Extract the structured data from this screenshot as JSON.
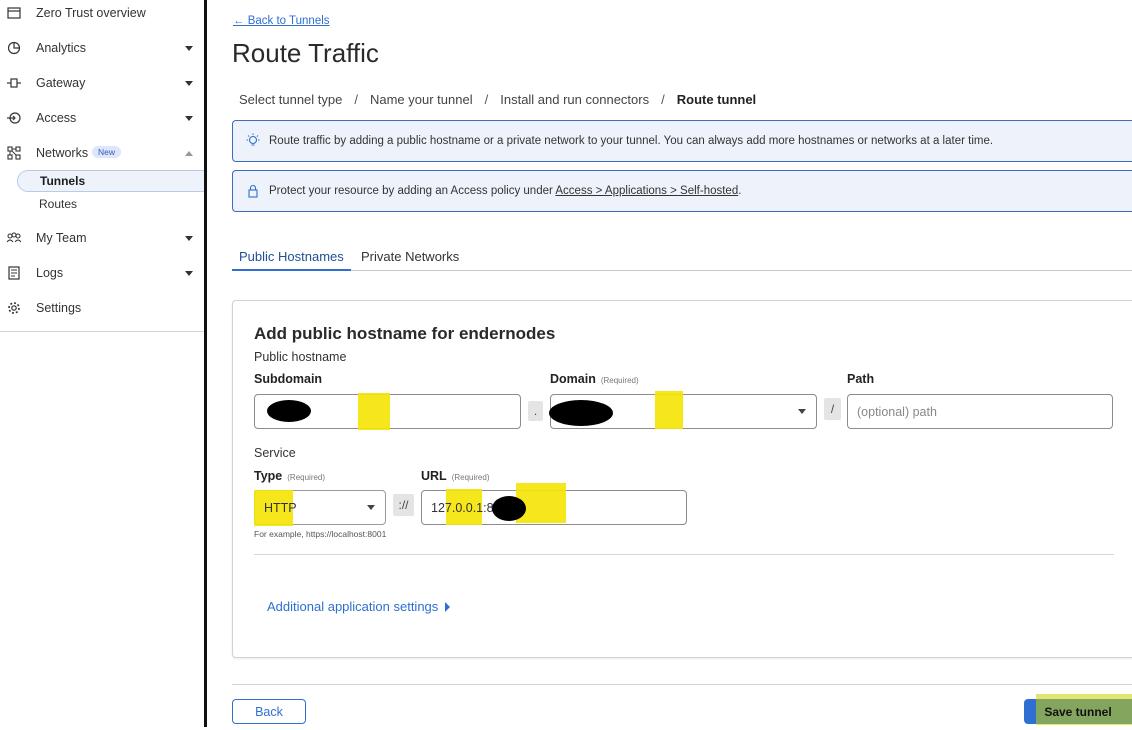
{
  "sidebar": {
    "items": [
      {
        "label": "Zero Trust overview",
        "icon": "window-icon"
      },
      {
        "label": "Analytics",
        "icon": "chart-icon"
      },
      {
        "label": "Gateway",
        "icon": "gateway-icon"
      },
      {
        "label": "Access",
        "icon": "login-icon"
      },
      {
        "label": "Networks",
        "icon": "network-icon",
        "badge": "New"
      },
      {
        "label": "My Team",
        "icon": "team-icon"
      },
      {
        "label": "Logs",
        "icon": "logs-icon"
      },
      {
        "label": "Settings",
        "icon": "gear-icon"
      }
    ],
    "subitems": [
      {
        "label": "Tunnels",
        "active": true
      },
      {
        "label": "Routes",
        "active": false
      }
    ]
  },
  "main": {
    "back_link": "← Back to Tunnels",
    "title": "Route Traffic",
    "steps": [
      "Select tunnel type",
      "Name your tunnel",
      "Install and run connectors",
      "Route tunnel"
    ],
    "step_separator": "/",
    "info_route": "Route traffic by adding a public hostname or a private network to your tunnel. You can always add more hostnames or networks at a later time.",
    "info_access_prefix": "Protect your resource by adding an Access policy under ",
    "info_access_link": "Access > Applications > Self-hosted",
    "info_access_suffix": ".",
    "tabs": [
      "Public Hostnames",
      "Private Networks"
    ],
    "card": {
      "title": "Add public hostname for endernodes",
      "subtitle": "Public hostname",
      "subdomain_label": "Subdomain",
      "domain_label": "Domain",
      "path_label": "Path",
      "required": "(Required)",
      "dot": ".",
      "slash": "/",
      "path_placeholder": "(optional) path",
      "service_label": "Service",
      "type_label": "Type",
      "type_value": "HTTP",
      "scheme_sep": "://",
      "url_label": "URL",
      "url_value": "127.0.0.1:8",
      "example_hint": "For example, https://localhost:8001",
      "advanced_link": "Additional application settings"
    },
    "back_button": "Back",
    "save_button": "Save tunnel"
  },
  "colors": {
    "accent": "#2f6fd1",
    "info_bg": "#eef3fb",
    "highlight": "#f5e50a"
  }
}
